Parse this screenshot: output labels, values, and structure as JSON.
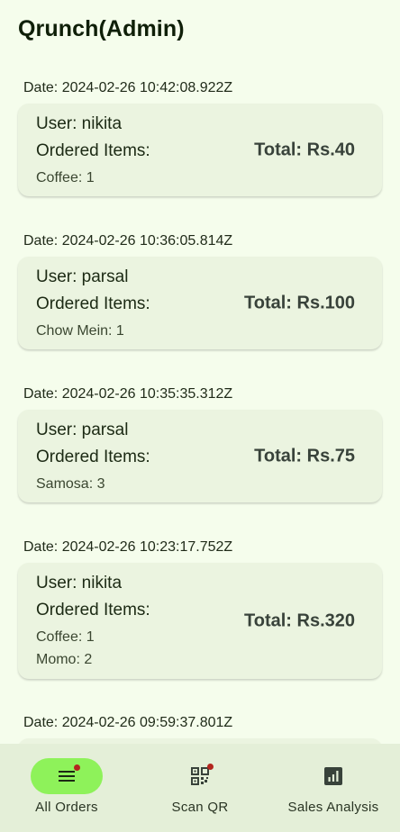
{
  "app": {
    "title": "Qrunch(Admin)"
  },
  "orders": [
    {
      "date": "Date: 2024-02-26 10:42:08.922Z",
      "user": "User: nikita",
      "ordered_label": "Ordered Items:",
      "items": [
        "Coffee: 1"
      ],
      "total": "Total: Rs.40"
    },
    {
      "date": "Date: 2024-02-26 10:36:05.814Z",
      "user": "User: parsal",
      "ordered_label": "Ordered Items:",
      "items": [
        "Chow Mein: 1"
      ],
      "total": "Total: Rs.100"
    },
    {
      "date": "Date: 2024-02-26 10:35:35.312Z",
      "user": "User: parsal",
      "ordered_label": "Ordered Items:",
      "items": [
        "Samosa: 3"
      ],
      "total": "Total: Rs.75"
    },
    {
      "date": "Date: 2024-02-26 10:23:17.752Z",
      "user": "User: nikita",
      "ordered_label": "Ordered Items:",
      "items": [
        "Coffee: 1",
        "Momo: 2"
      ],
      "total": "Total: Rs.320"
    },
    {
      "date": "Date: 2024-02-26 09:59:37.801Z",
      "user": "",
      "ordered_label": "",
      "items": [],
      "total": ""
    }
  ],
  "nav": {
    "all_orders": {
      "label": "All Orders",
      "icon": "menu-icon",
      "active": true,
      "badge": true
    },
    "scan_qr": {
      "label": "Scan QR",
      "icon": "qr-code-icon",
      "active": false,
      "badge": true
    },
    "sales_analysis": {
      "label": "Sales Analysis",
      "icon": "bar-chart-icon",
      "active": false,
      "badge": false
    }
  },
  "colors": {
    "background": "#f5fdec",
    "card": "#ebf4e0",
    "nav_background": "#e4efd8",
    "nav_active_pill": "#8ef25a",
    "badge": "#b3261e"
  }
}
